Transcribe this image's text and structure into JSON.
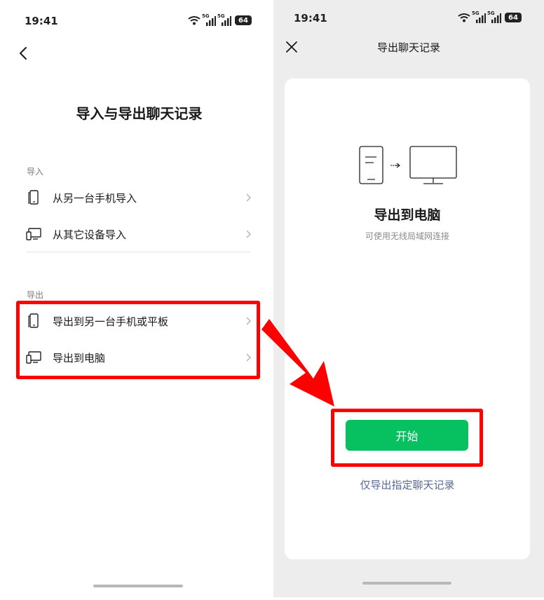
{
  "left_screen": {
    "status": {
      "time": "19:41",
      "network_1": "5G",
      "network_2": "5G",
      "battery": "64"
    },
    "title": "导入与导出聊天记录",
    "import_section": {
      "label": "导入",
      "items": [
        {
          "label": "从另一台手机导入",
          "icon": "phone-icon"
        },
        {
          "label": "从其它设备导入",
          "icon": "devices-icon"
        }
      ]
    },
    "export_section": {
      "label": "导出",
      "items": [
        {
          "label": "导出到另一台手机或平板",
          "icon": "phone-icon"
        },
        {
          "label": "导出到电脑",
          "icon": "devices-icon"
        }
      ]
    }
  },
  "right_screen": {
    "status": {
      "time": "19:41",
      "network_1": "5G",
      "network_2": "5G",
      "battery": "64"
    },
    "nav_title": "导出聊天记录",
    "card": {
      "title": "导出到电脑",
      "subtitle": "可使用无线局域网连接",
      "start_button": "开始",
      "selective_link": "仅导出指定聊天记录"
    }
  },
  "colors": {
    "accent_green": "#07c160",
    "link_blue": "#576b95",
    "highlight_red": "#ff0000",
    "page_gray": "#ededed"
  }
}
